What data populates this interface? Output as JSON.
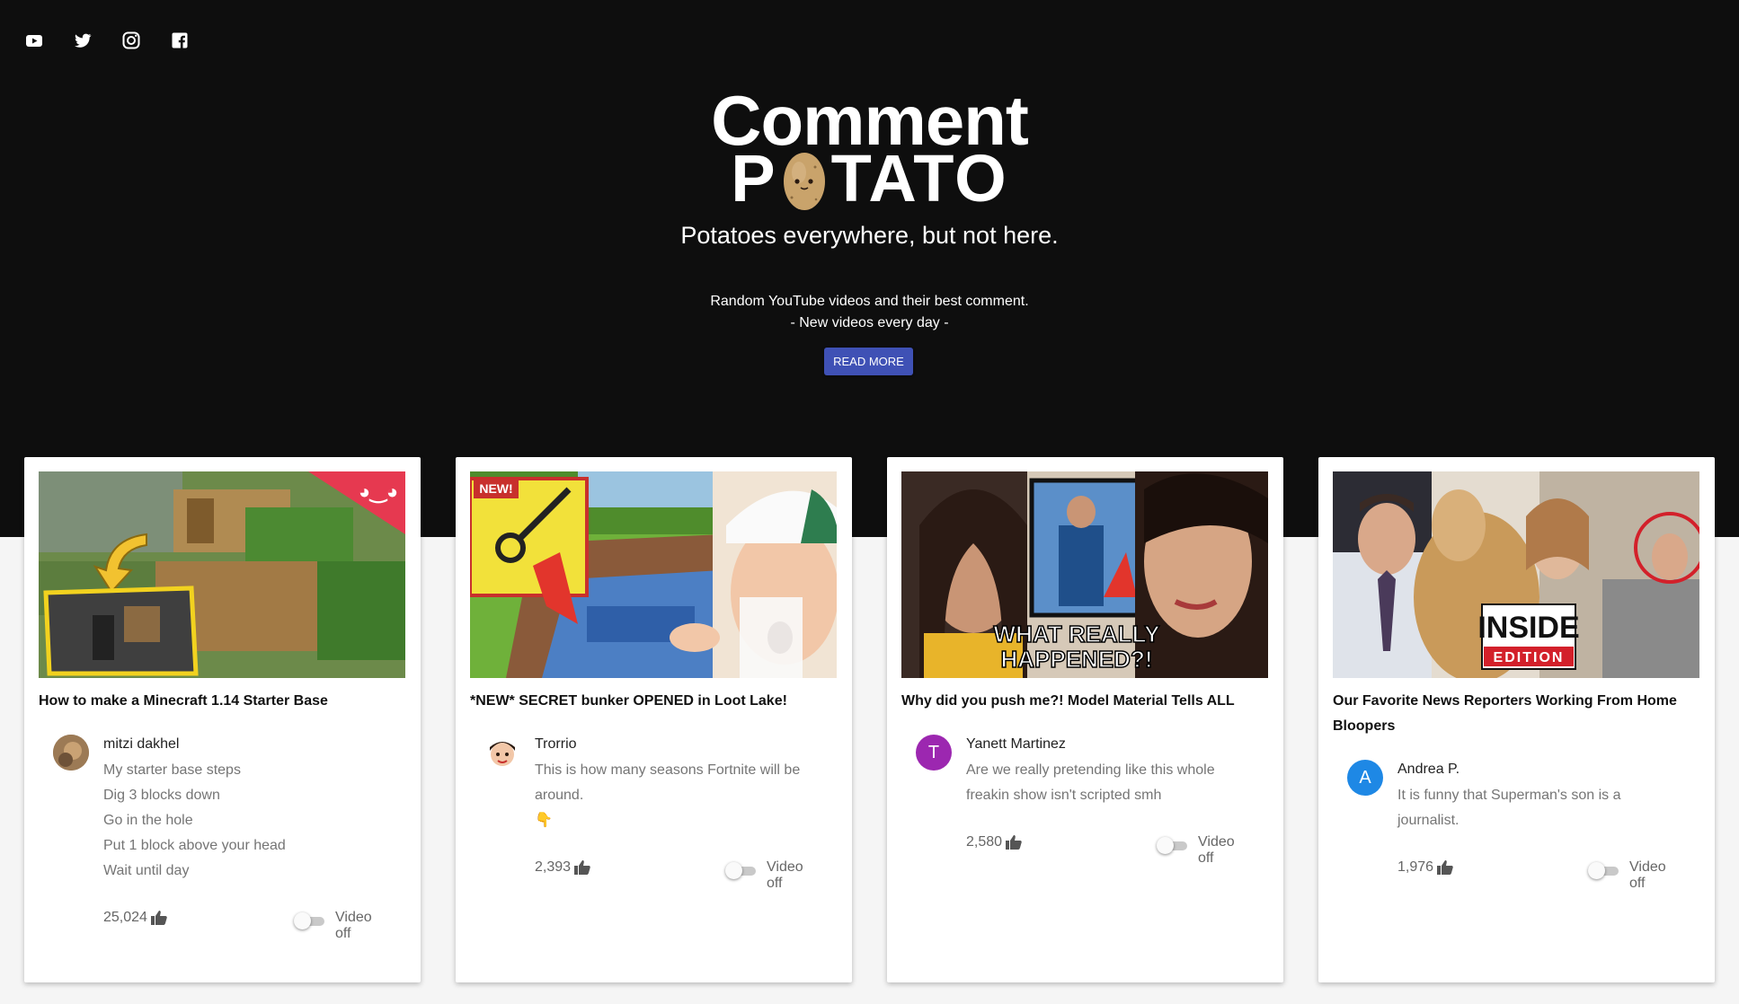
{
  "social": [
    {
      "icon": "youtube-icon"
    },
    {
      "icon": "twitter-icon"
    },
    {
      "icon": "instagram-icon"
    },
    {
      "icon": "facebook-icon"
    }
  ],
  "logo": {
    "line1": "Comment",
    "line2_left": "P",
    "line2_right": "TATO"
  },
  "tagline": "Potatoes everywhere, but not here.",
  "intro": {
    "line1": "Random YouTube videos and their best comment.",
    "line2": "- New videos every day -"
  },
  "read_more_label": "READ MORE",
  "colors": {
    "hero_bg": "#0e0e0e",
    "button": "#3f51b5",
    "avatar_t": "#9c27b0",
    "avatar_a": "#1e88e5"
  },
  "cards": [
    {
      "title": "How to make a Minecraft 1.14 Starter Base",
      "author": "mitzi dakhel",
      "avatar_letter": "",
      "comment": "My starter base steps\nDig 3 blocks down\nGo in the hole\nPut 1 block above your head\nWait until day",
      "likes": "25,024",
      "video_toggle_label": "Video off",
      "video_on": false
    },
    {
      "title": "*NEW* SECRET bunker OPENED in Loot Lake!",
      "author": "Trorrio",
      "avatar_letter": "",
      "comment": "This is how many seasons Fortnite will be around.\n👇",
      "likes": "2,393",
      "video_toggle_label": "Video off",
      "video_on": false
    },
    {
      "title": "Why did you push me?! Model Material Tells ALL",
      "author": "Yanett Martinez",
      "avatar_letter": "T",
      "comment": "Are we really pretending like this whole freakin show isn't scripted smh",
      "likes": "2,580",
      "video_toggle_label": "Video off",
      "video_on": false
    },
    {
      "title": "Our Favorite News Reporters Working From Home Bloopers",
      "author": "Andrea P.",
      "avatar_letter": "A",
      "comment": "It is funny that Superman's son is a journalist.",
      "likes": "1,976",
      "video_toggle_label": "Video off",
      "video_on": false
    }
  ],
  "thumb_overlays": {
    "card0": "",
    "card1": "NEW!",
    "card2_line1": "WHAT REALLY",
    "card2_line2": "HAPPENED?!",
    "card3_line1": "INSIDE",
    "card3_line2": "EDITION"
  }
}
